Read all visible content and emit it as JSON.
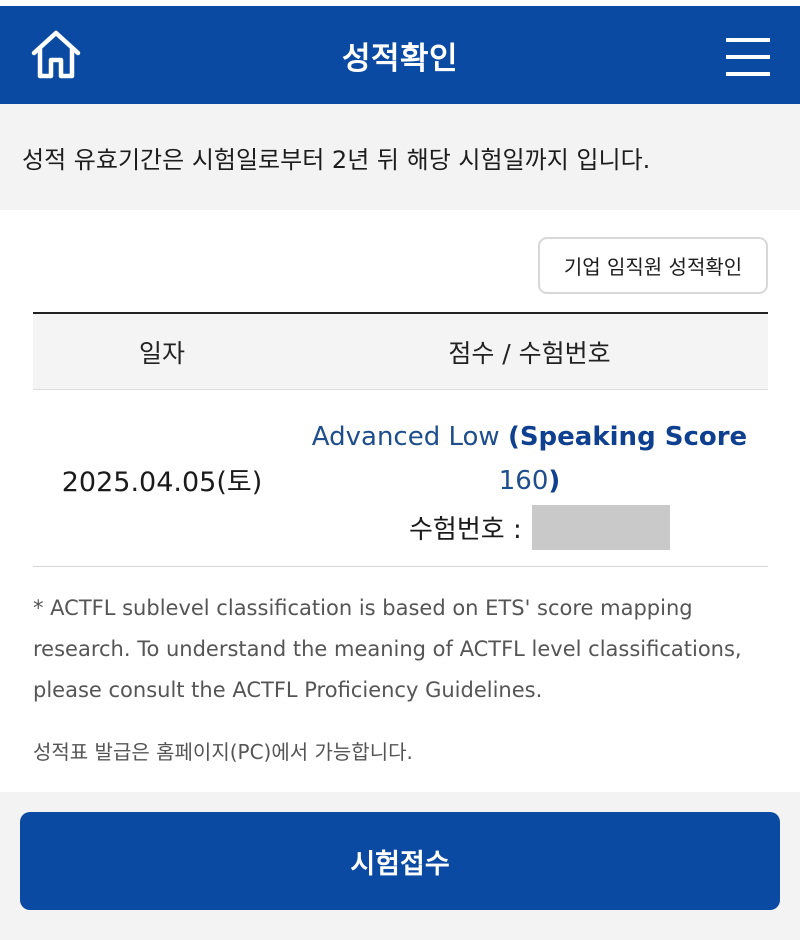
{
  "header": {
    "title": "성적확인",
    "left_icon": "home-icon",
    "right_icon": "menu-icon",
    "color": "#0b4aa2"
  },
  "notice": {
    "text": "성적 유효기간은 시험일로부터 2년 뒤 해당 시험일까지 입니다."
  },
  "corporate_button": {
    "label": "기업 임직원 성적확인"
  },
  "table": {
    "headers": {
      "date": "일자",
      "score": "점수 / 수험번호"
    },
    "rows": [
      {
        "date": "2025.04.05(토)",
        "level": "Advanced Low",
        "score_detail_prefix": "(Speaking Score",
        "score_value": "160",
        "score_detail_suffix": ")",
        "exam_no_label": "수험번호 :",
        "exam_no_value": ""
      }
    ]
  },
  "footnote": {
    "text": "* ACTFL sublevel classification is based on ETS' score mapping research. To understand the meaning of ACTFL level classifications, please consult the ACTFL Proficiency Guidelines."
  },
  "pc_note": {
    "text": "성적표 발급은 홈페이지(PC)에서 가능합니다."
  },
  "apply_button": {
    "label": "시험접수",
    "color": "#0b4aa2"
  }
}
